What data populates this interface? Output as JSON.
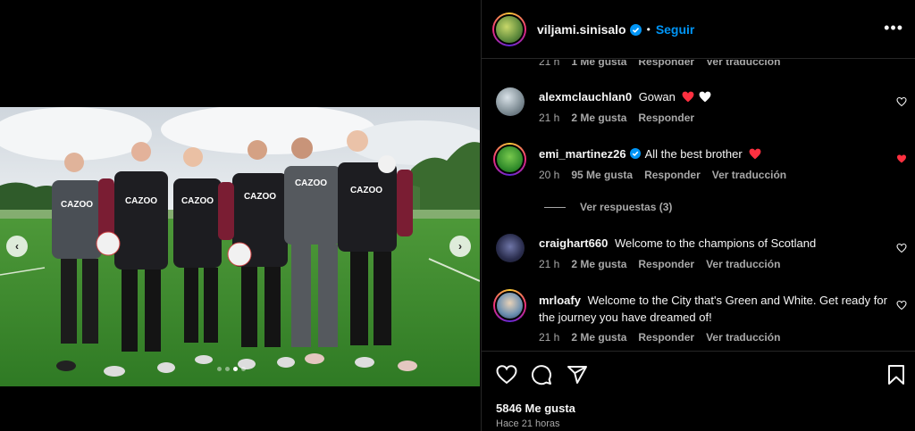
{
  "post": {
    "username": "viljami.sinisalo",
    "separator": "•",
    "follow_label": "Seguir",
    "more_label": "•••",
    "likes": "5846 Me gusta",
    "posted": "Hace 21 horas"
  },
  "carousel": {
    "prev_label": "‹",
    "next_label": "›",
    "dots_total": 4,
    "active_dot": 2
  },
  "comments": {
    "partial_meta": {
      "time": "21 h",
      "likes": "1 Me gusta",
      "reply": "Responder",
      "translate": "Ver traducción"
    },
    "items": [
      {
        "user": "alexmclauchlan0",
        "text": "Gowan",
        "emoji": [
          "red-heart",
          "white-heart"
        ],
        "time": "21 h",
        "likes": "2 Me gusta",
        "reply": "Responder",
        "translate": "",
        "liked": false
      },
      {
        "user": "emi_martinez26",
        "text": "All the best brother",
        "emoji": [
          "red-heart"
        ],
        "verified": true,
        "time": "20 h",
        "likes": "95 Me gusta",
        "reply": "Responder",
        "translate": "Ver traducción",
        "liked": true
      },
      {
        "user": "craighart660",
        "text": "Welcome to the champions of Scotland",
        "time": "21 h",
        "likes": "2 Me gusta",
        "reply": "Responder",
        "translate": "Ver traducción",
        "liked": false
      },
      {
        "user": "mrloafy",
        "text": "Welcome to the City that's Green and White. Get ready for the journey you have dreamed of!",
        "time": "21 h",
        "likes": "2 Me gusta",
        "reply": "Responder",
        "translate": "Ver traducción",
        "liked": false
      }
    ],
    "view_replies": "Ver respuestas (3)"
  },
  "photo": {
    "shirt_text": "CAZOO"
  },
  "colors": {
    "accent": "#0095f6",
    "liked": "#ff3040",
    "muted": "#a8a8a8",
    "text": "#f5f5f5"
  }
}
